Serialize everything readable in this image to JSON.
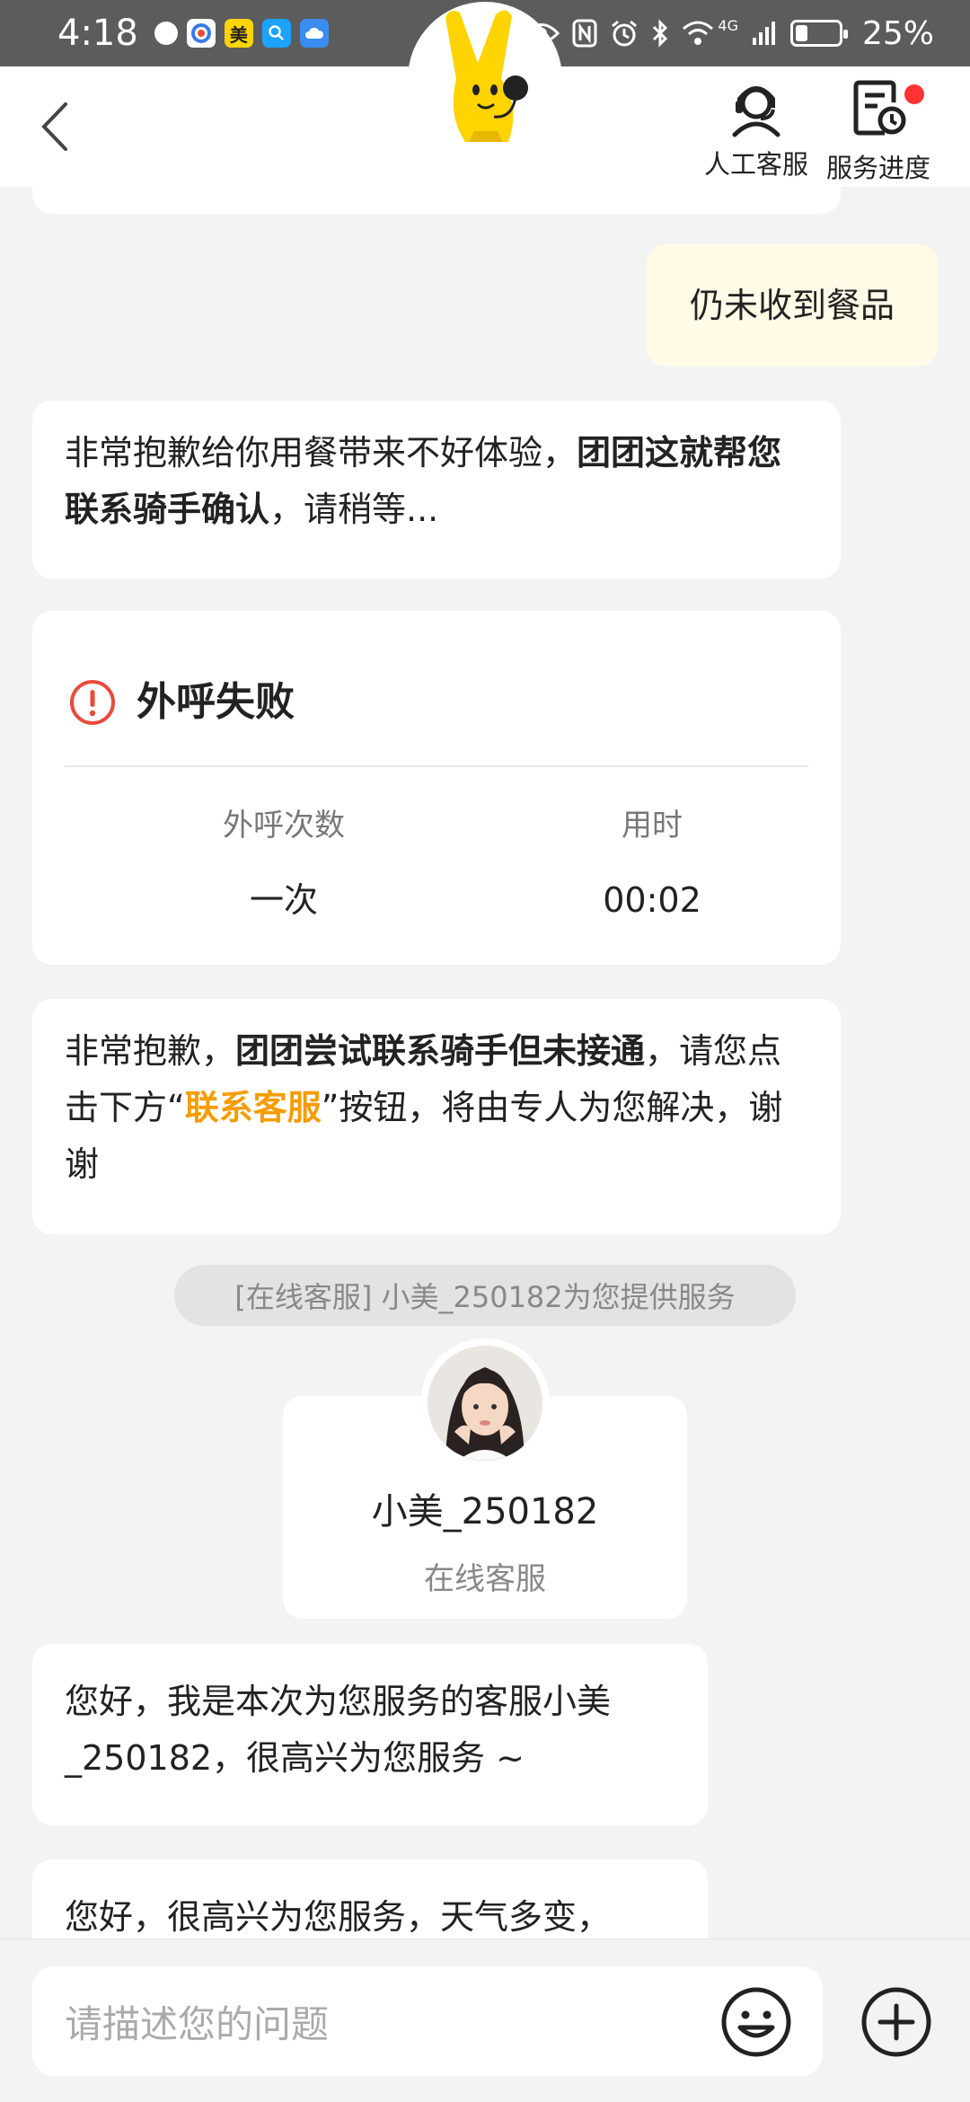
{
  "status_bar": {
    "time": "4:18",
    "battery_percent": "25%",
    "battery_level": 0.25,
    "network": "4G",
    "app_badge_text": "美"
  },
  "nav": {
    "customer_service_label": "人工客服",
    "service_progress_label": "服务进度",
    "has_notification_dot": true
  },
  "messages": {
    "user_message": "仍未收到餐品",
    "bot_msg1": {
      "text_a": "非常抱歉给你用餐带来不好体验，",
      "bold_a": "团团这就帮您联系骑手确认",
      "text_b": "，请稍等..."
    },
    "call_result": {
      "title": "外呼失败",
      "count_label": "外呼次数",
      "count_value": "一次",
      "duration_label": "用时",
      "duration_value": "00:02"
    },
    "bot_msg2": {
      "text_a": "非常抱歉，",
      "bold_a": "团团尝试联系骑手但未接通",
      "text_b": "，请您点击下方“",
      "link": "联系客服",
      "text_c": "”按钮，将由专人为您解决，谢谢"
    },
    "system_notice": "[在线客服] 小美_250182为您提供服务",
    "agent": {
      "name": "小美_250182",
      "role": "在线客服"
    },
    "agent_msg1": "您好，我是本次为您服务的客服小美_250182，很高兴为您服务 ~",
    "agent_msg2_partial": "您好，很高兴为您服务，天气多变，"
  },
  "input": {
    "placeholder": "请描述您的问题"
  },
  "colors": {
    "accent_orange": "#f59c00",
    "alert_red": "#e84a3c",
    "mascot_yellow": "#ffd400",
    "user_bubble": "#fffbe6"
  },
  "icons": [
    "back-chevron-icon",
    "headset-icon",
    "service-progress-icon",
    "alert-icon",
    "emoji-icon",
    "plus-icon"
  ]
}
